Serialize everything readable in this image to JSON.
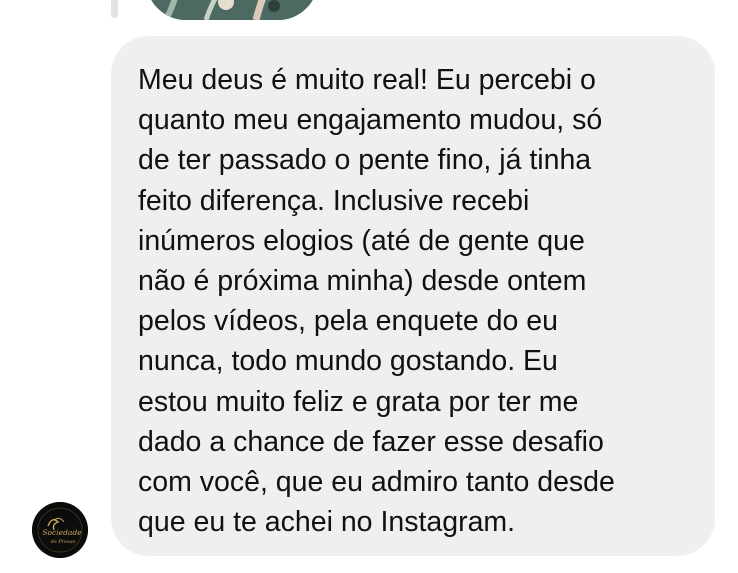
{
  "chat": {
    "message": {
      "text": "Meu deus é muito real! Eu percebi o\nquanto meu engajamento mudou, só\nde ter passado o pente fino, já tinha\nfeito diferença. Inclusive recebi\ninúmeros elogios (até de gente que\nnão é próxima minha) desde ontem\npelos vídeos, pela enquete do eu\nnunca, todo mundo gostando. Eu\nestou muito feliz e grata por ter me\ndado a chance de fazer esse desafio\ncom você, que eu admiro tanto desde\nque eu te achei no Instagram."
    },
    "quoted_media": {
      "icon": "image-thumbnail"
    },
    "sender_avatar": {
      "icon": "brand-logo-avatar",
      "logo_text_line1": "Sociedade",
      "logo_text_line2": "de Prosas"
    }
  },
  "colors": {
    "bubble_background": "#efeff0",
    "text": "#111111",
    "avatar_background": "#0c0c0c",
    "logo_gold": "#c9a55a"
  }
}
